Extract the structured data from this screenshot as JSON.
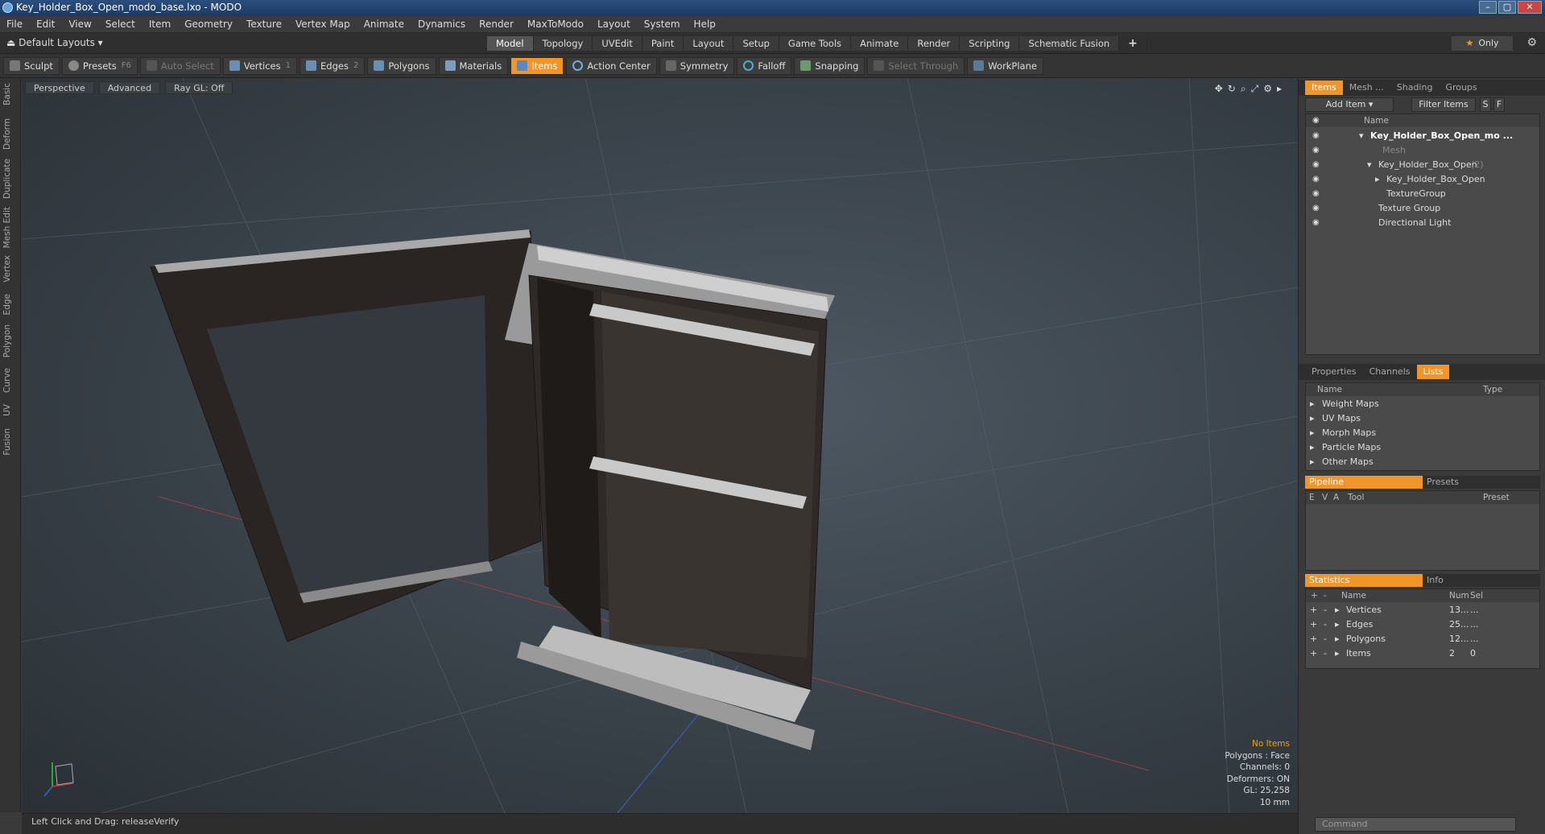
{
  "window": {
    "title": "Key_Holder_Box_Open_modo_base.lxo - MODO",
    "min": "–",
    "max": "▢",
    "close": "✕"
  },
  "menu": [
    "File",
    "Edit",
    "View",
    "Select",
    "Item",
    "Geometry",
    "Texture",
    "Vertex Map",
    "Animate",
    "Dynamics",
    "Render",
    "MaxToModo",
    "Layout",
    "System",
    "Help"
  ],
  "layoutbar": {
    "layout_label": "Default Layouts ▾",
    "tabs": [
      "Model",
      "Topology",
      "UVEdit",
      "Paint",
      "Layout",
      "Setup",
      "Game Tools",
      "Animate",
      "Render",
      "Scripting",
      "Schematic Fusion"
    ],
    "active_tab": "Model",
    "plus": "+",
    "only_label": "Only"
  },
  "toolbar": {
    "sculpt": "Sculpt",
    "presets": "Presets",
    "presets_key": "F6",
    "auto_select": "Auto Select",
    "vertices": "Vertices",
    "vertices_key": "1",
    "edges": "Edges",
    "edges_key": "2",
    "polygons": "Polygons",
    "materials": "Materials",
    "items": "Items",
    "action_center": "Action Center",
    "symmetry": "Symmetry",
    "falloff": "Falloff",
    "snapping": "Snapping",
    "select_through": "Select Through",
    "workplane": "WorkPlane"
  },
  "lefttabs": [
    "Basic",
    "Deform",
    "Duplicate",
    "Mesh Edit",
    "Vertex",
    "Edge",
    "Polygon",
    "Curve",
    "UV",
    "Fusion"
  ],
  "viewport": {
    "view_mode": "Perspective",
    "shading": "Advanced",
    "raygl": "Ray GL: Off",
    "info": {
      "no_items": "No Items",
      "polygons": "Polygons : Face",
      "channels": "Channels: 0",
      "deformers": "Deformers: ON",
      "gl": "GL: 25,258",
      "scale": "10 mm"
    }
  },
  "status": {
    "text": "Left Click and Drag:   releaseVerify"
  },
  "itemspanel": {
    "tabs": [
      "Items",
      "Mesh ...",
      "Shading",
      "Groups"
    ],
    "add_item": "Add Item",
    "filter_items": "Filter Items",
    "s_btn": "S",
    "f_btn": "F",
    "col_name": "Name",
    "rows": [
      {
        "label": "Key_Holder_Box_Open_mo ..."
      },
      {
        "label": "Mesh"
      },
      {
        "label": "Key_Holder_Box_Open",
        "suffix": "(2)"
      },
      {
        "label": "Key_Holder_Box_Open"
      },
      {
        "label": "TextureGroup"
      },
      {
        "label": "Texture Group"
      },
      {
        "label": "Directional Light"
      }
    ]
  },
  "listspanel": {
    "tabs": [
      "Properties",
      "Channels",
      "Lists"
    ],
    "col_name": "Name",
    "col_type": "Type",
    "rows": [
      "Weight Maps",
      "UV Maps",
      "Morph Maps",
      "Particle Maps",
      "Other Maps"
    ]
  },
  "pipeline": {
    "tabs": [
      "Pipeline",
      "Presets"
    ],
    "cols": [
      "E",
      "V",
      "A",
      "Tool",
      "Preset"
    ]
  },
  "stats": {
    "tabs": [
      "Statistics",
      "Info"
    ],
    "cols": {
      "name": "Name",
      "num": "Num",
      "sel": "Sel"
    },
    "rows": [
      {
        "name": "Vertices",
        "num": "13...",
        "sel": "..."
      },
      {
        "name": "Edges",
        "num": "25...",
        "sel": "..."
      },
      {
        "name": "Polygons",
        "num": "12...",
        "sel": "..."
      },
      {
        "name": "Items",
        "num": "2",
        "sel": "0"
      }
    ]
  },
  "command": {
    "placeholder": "Command"
  },
  "colors": {
    "accent": "#f0952a",
    "bg": "#3a3a3a",
    "viewport": "#3c454d"
  }
}
